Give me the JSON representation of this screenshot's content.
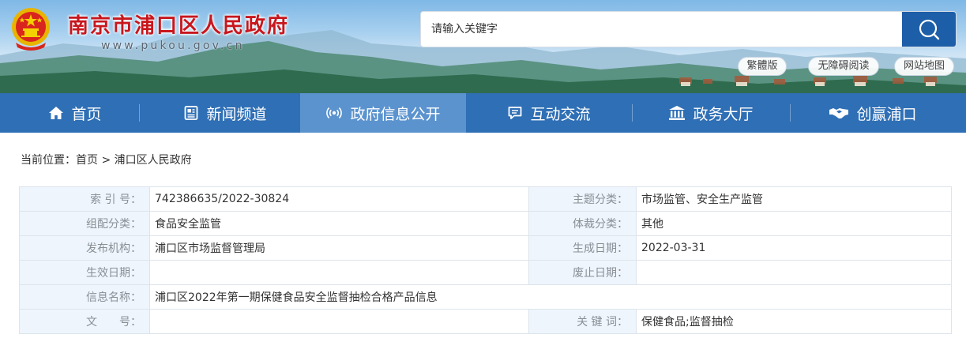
{
  "header": {
    "site_title": "南京市浦口区人民政府",
    "site_url": "www.pukou.gov.cn",
    "search": {
      "placeholder": "请输入关键字"
    },
    "links": [
      {
        "label": "繁體版"
      },
      {
        "label": "无障碍阅读"
      },
      {
        "label": "网站地图"
      }
    ]
  },
  "nav": {
    "items": [
      {
        "label": "首页",
        "icon": "home-icon"
      },
      {
        "label": "新闻频道",
        "icon": "newspaper-icon"
      },
      {
        "label": "政府信息公开",
        "icon": "broadcast-icon",
        "active": true
      },
      {
        "label": "互动交流",
        "icon": "chat-icon"
      },
      {
        "label": "政务大厅",
        "icon": "building-icon"
      },
      {
        "label": "创赢浦口",
        "icon": "handshake-icon"
      }
    ]
  },
  "breadcrumb": {
    "prefix": "当前位置：",
    "items": [
      "首页",
      "浦口区人民政府"
    ],
    "separator": " > "
  },
  "meta": {
    "rows": [
      [
        {
          "k": "索 引 号：",
          "v": "742386635/2022-30824"
        },
        {
          "k": "主题分类：",
          "v": "市场监管、安全生产监管"
        }
      ],
      [
        {
          "k": "组配分类：",
          "v": "食品安全监管"
        },
        {
          "k": "体裁分类：",
          "v": "其他"
        }
      ],
      [
        {
          "k": "发布机构：",
          "v": "浦口区市场监督管理局"
        },
        {
          "k": "生成日期：",
          "v": "2022-03-31"
        }
      ],
      [
        {
          "k": "生效日期：",
          "v": ""
        },
        {
          "k": "废止日期：",
          "v": ""
        }
      ],
      [
        {
          "k": "信息名称：",
          "v": "浦口区2022年第一期保健食品安全监督抽检合格产品信息"
        }
      ],
      [
        {
          "k": "文　　号：",
          "v": ""
        },
        {
          "k": "关 键 词：",
          "v": "保健食品;监督抽检"
        }
      ]
    ]
  },
  "colors": {
    "brand_red": "#c8161d",
    "nav_blue": "#2f6fb5",
    "nav_active": "#5b93cf",
    "search_button": "#1d5ea8",
    "label_bg": "#eef5fc"
  }
}
